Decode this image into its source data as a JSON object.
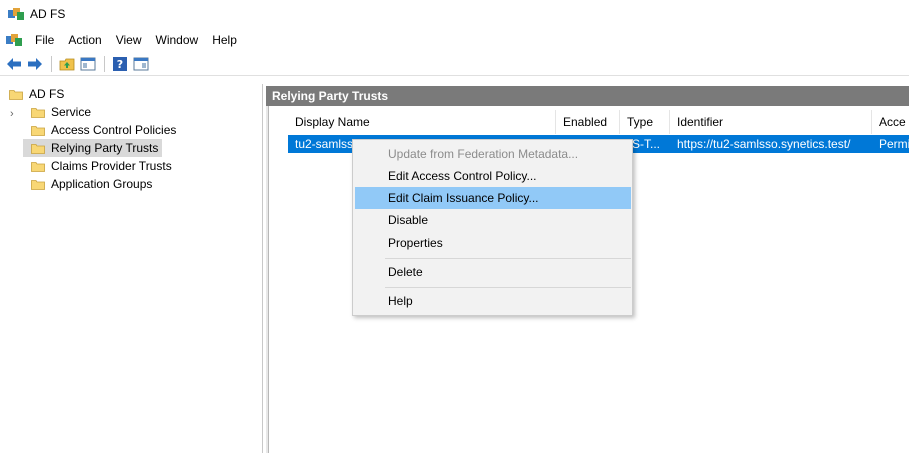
{
  "window": {
    "title": "AD FS"
  },
  "menubar": {
    "items": [
      "File",
      "Action",
      "View",
      "Window",
      "Help"
    ]
  },
  "toolbar": {
    "buttons": [
      "back-arrow-icon",
      "forward-arrow-icon",
      "up-folder-icon",
      "show-hide-tree-icon",
      "help-icon",
      "action-pane-icon"
    ]
  },
  "tree": {
    "root": "AD FS",
    "items": [
      {
        "label": "Service",
        "expandable": true
      },
      {
        "label": "Access Control Policies"
      },
      {
        "label": "Relying Party Trusts",
        "selected": true
      },
      {
        "label": "Claims Provider Trusts"
      },
      {
        "label": "Application Groups"
      }
    ]
  },
  "pane": {
    "header": "Relying Party Trusts",
    "columns": [
      "Display Name",
      "Enabled",
      "Type",
      "Identifier",
      "Acce"
    ],
    "rows": [
      {
        "display_name": "tu2-samlssc",
        "enabled": "",
        "type": "VS-T...",
        "identifier": "https://tu2-samlsso.synetics.test/",
        "access": "Permi"
      }
    ]
  },
  "context_menu": {
    "items": [
      {
        "label": "Update from Federation Metadata...",
        "disabled": true
      },
      {
        "label": "Edit Access Control Policy..."
      },
      {
        "label": "Edit Claim Issuance Policy...",
        "highlighted": true
      },
      {
        "label": "Disable"
      },
      {
        "label": "Properties"
      },
      {
        "label": "Delete"
      },
      {
        "label": "Help"
      }
    ]
  },
  "colors": {
    "selection_blue": "#0078d7",
    "menu_highlight": "#91c9f7",
    "header_gray": "#7a7a7a",
    "folder_yellow": "#f8d775"
  }
}
